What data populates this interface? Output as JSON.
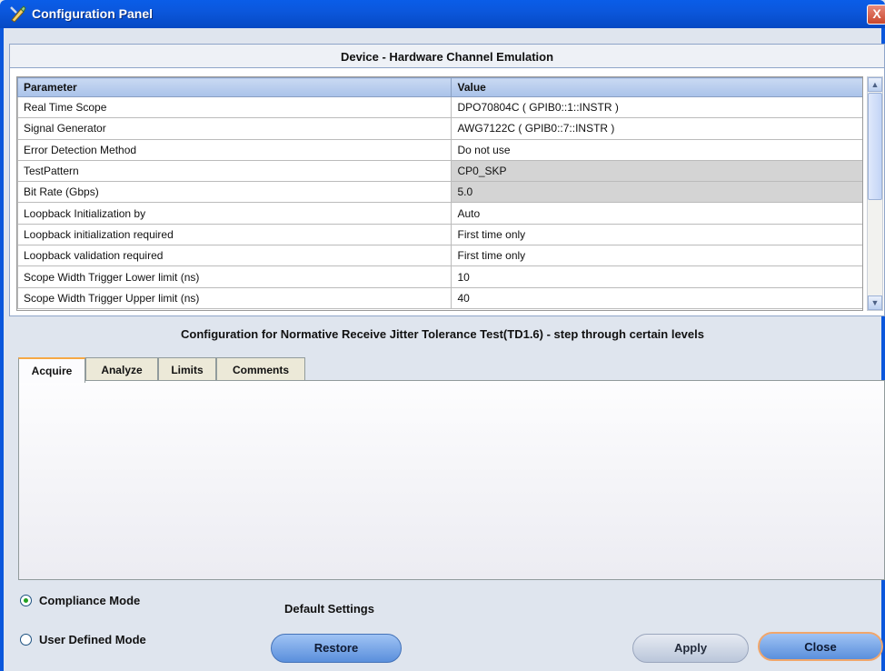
{
  "window": {
    "title": "Configuration Panel",
    "close_glyph": "X",
    "icon": "pen-wrench-icon"
  },
  "device_panel": {
    "header": "Device - Hardware Channel Emulation",
    "columns": [
      "Parameter",
      "Value"
    ],
    "rows": [
      {
        "parameter": "Real Time Scope",
        "value": "DPO70804C ( GPIB0::1::INSTR )",
        "readonly": false
      },
      {
        "parameter": "Signal Generator",
        "value": "AWG7122C ( GPIB0::7::INSTR )",
        "readonly": false
      },
      {
        "parameter": "Error Detection Method",
        "value": "Do not use",
        "readonly": false
      },
      {
        "parameter": "TestPattern",
        "value": "CP0_SKP",
        "readonly": true
      },
      {
        "parameter": "Bit Rate (Gbps)",
        "value": "5.0",
        "readonly": true
      },
      {
        "parameter": "Loopback Initialization by",
        "value": "Auto",
        "readonly": false
      },
      {
        "parameter": "Loopback initialization required",
        "value": "First time only",
        "readonly": false
      },
      {
        "parameter": "Loopback validation required",
        "value": "First time only",
        "readonly": false
      },
      {
        "parameter": "Scope Width Trigger Lower limit (ns)",
        "value": "10",
        "readonly": false
      },
      {
        "parameter": "Scope Width Trigger Upper limit (ns)",
        "value": "40",
        "readonly": false
      }
    ]
  },
  "test_config": {
    "title": "Configuration for Normative Receive Jitter Tolerance Test(TD1.6) - step through certain levels",
    "tabs": [
      "Acquire",
      "Analyze",
      "Limits",
      "Comments"
    ],
    "active_tab": "Acquire"
  },
  "modes": {
    "compliance": "Compliance Mode",
    "user_defined": "User Defined Mode",
    "selected": "Compliance Mode"
  },
  "default_settings": {
    "label": "Default Settings",
    "restore_label": "Restore"
  },
  "actions": {
    "apply_label": "Apply",
    "close_label": "Close"
  },
  "colors": {
    "title_bar": "#0b57dc",
    "button_blue": "#5a8fdc",
    "active_tab_accent": "#f6a845",
    "readonly_cell": "#d4d4d4"
  }
}
